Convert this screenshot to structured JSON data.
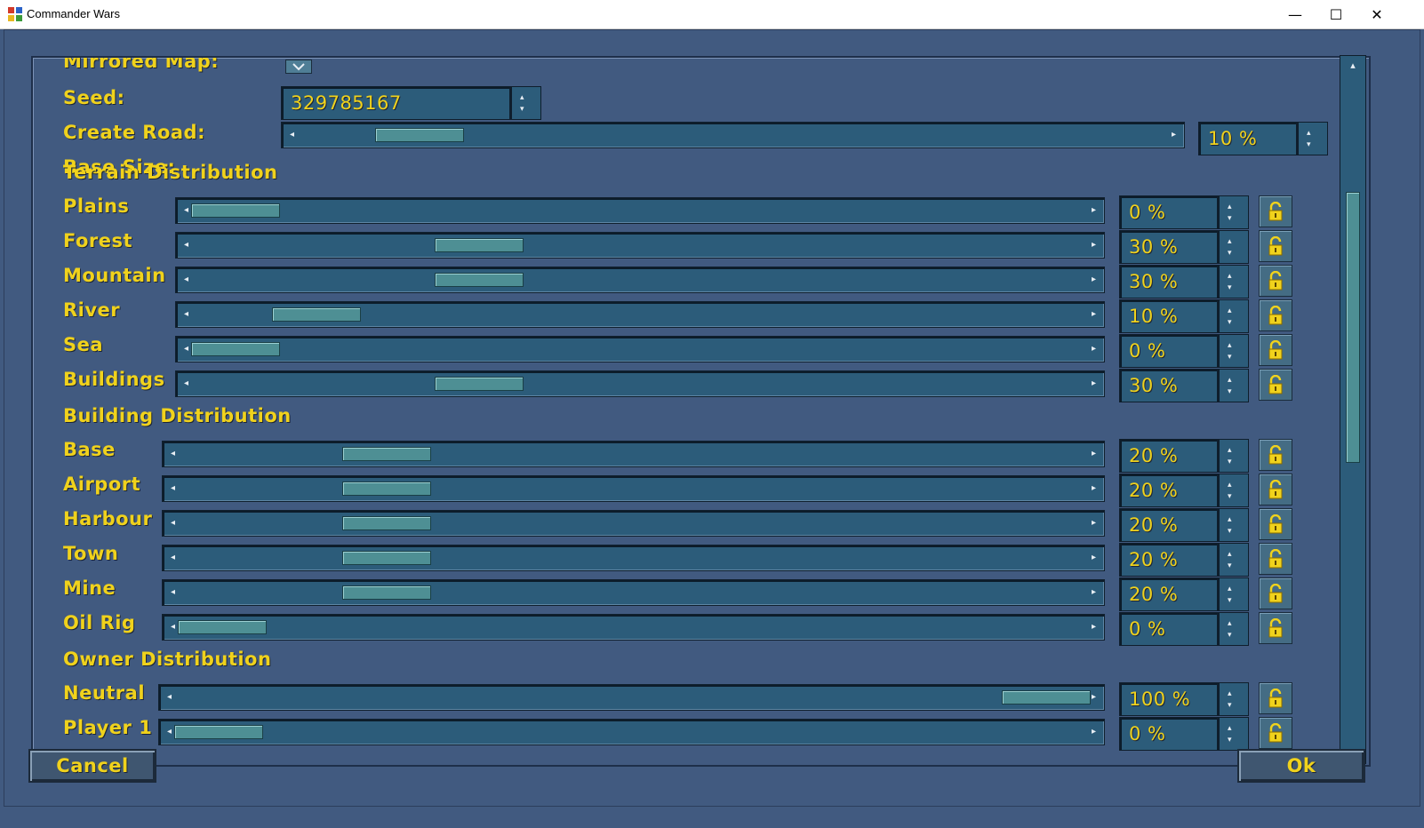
{
  "window": {
    "title": "Commander Wars",
    "minimize": "—",
    "maximize": "☐",
    "close": "✕"
  },
  "general": {
    "mirrored_map_label": "Mirrored Map:",
    "seed_label": "Seed:",
    "seed_value": "329785167",
    "create_road_label": "Create Road:",
    "create_road_value": "10 %",
    "create_road_percent": 10,
    "base_size_label": "Base Size:"
  },
  "terrain": {
    "heading": "Terrain Distribution",
    "rows": [
      {
        "label": "Plains",
        "value": "0 %",
        "percent": 0
      },
      {
        "label": "Forest",
        "value": "30 %",
        "percent": 30
      },
      {
        "label": "Mountain",
        "value": "30 %",
        "percent": 30
      },
      {
        "label": "River",
        "value": "10 %",
        "percent": 10
      },
      {
        "label": "Sea",
        "value": "0 %",
        "percent": 0
      },
      {
        "label": "Buildings",
        "value": "30 %",
        "percent": 30
      }
    ]
  },
  "buildings": {
    "heading": "Building Distribution",
    "rows": [
      {
        "label": "Base",
        "value": "20 %",
        "percent": 20
      },
      {
        "label": "Airport",
        "value": "20 %",
        "percent": 20
      },
      {
        "label": "Harbour",
        "value": "20 %",
        "percent": 20
      },
      {
        "label": "Town",
        "value": "20 %",
        "percent": 20
      },
      {
        "label": "Mine",
        "value": "20 %",
        "percent": 20
      },
      {
        "label": "Oil Rig",
        "value": "0 %",
        "percent": 0
      }
    ]
  },
  "owners": {
    "heading": "Owner Distribution",
    "rows": [
      {
        "label": "Neutral",
        "value": "100 %",
        "percent": 100
      },
      {
        "label": "Player 1",
        "value": "0 %",
        "percent": 0
      }
    ]
  },
  "icons": {
    "lock": "lock-icon",
    "arrow_left": "◂",
    "arrow_right": "▸",
    "arrow_up": "▴",
    "arrow_down": "▾"
  },
  "colors": {
    "background": "#415a80",
    "text": "#f0d21c",
    "slider": "#2c5c7a",
    "thumb": "#4e8f94"
  },
  "footer": {
    "cancel": "Cancel",
    "ok": "Ok"
  }
}
